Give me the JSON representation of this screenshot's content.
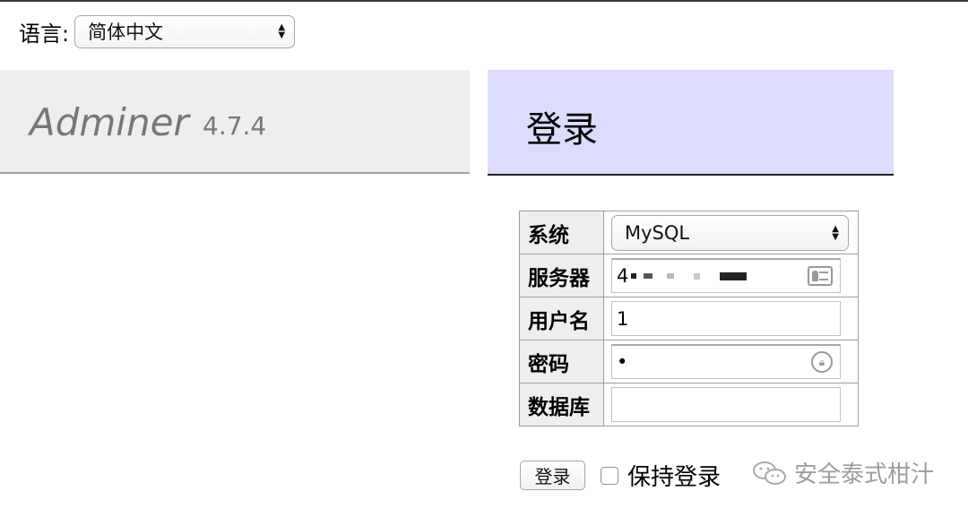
{
  "language": {
    "label": "语言:",
    "selected": "简体中文"
  },
  "brand": {
    "name": "Adminer",
    "version": "4.7.4"
  },
  "login": {
    "title": "登录",
    "fields": {
      "system": {
        "label": "系统",
        "value": "MySQL"
      },
      "server": {
        "label": "服务器",
        "value": "4"
      },
      "username": {
        "label": "用户名",
        "value": "1"
      },
      "password": {
        "label": "密码",
        "value": "•"
      },
      "database": {
        "label": "数据库",
        "value": ""
      }
    },
    "submit_label": "登录",
    "remember_label": "保持登录",
    "remember_checked": false
  },
  "watermark": {
    "text": "安全泰式柑汁"
  },
  "colors": {
    "login_header_bg": "#dcdcff",
    "brand_header_bg": "#eeeeee"
  }
}
